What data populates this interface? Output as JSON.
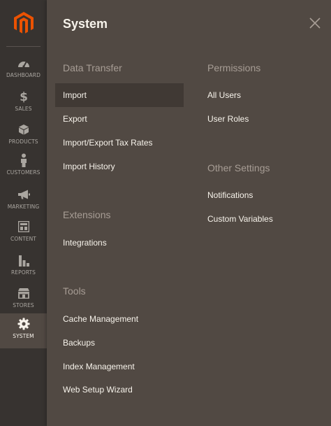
{
  "nav": {
    "items": [
      {
        "label": "DASHBOARD",
        "icon": "dashboard-icon"
      },
      {
        "label": "SALES",
        "icon": "dollar-icon"
      },
      {
        "label": "PRODUCTS",
        "icon": "box-icon"
      },
      {
        "label": "CUSTOMERS",
        "icon": "person-icon"
      },
      {
        "label": "MARKETING",
        "icon": "megaphone-icon"
      },
      {
        "label": "CONTENT",
        "icon": "layout-icon"
      },
      {
        "label": "REPORTS",
        "icon": "bar-chart-icon"
      },
      {
        "label": "STORES",
        "icon": "storefront-icon"
      },
      {
        "label": "SYSTEM",
        "icon": "gear-icon"
      }
    ],
    "active": "SYSTEM"
  },
  "panel": {
    "title": "System",
    "sections": {
      "data_transfer": {
        "title": "Data Transfer",
        "links": [
          "Import",
          "Export",
          "Import/Export Tax Rates",
          "Import History"
        ]
      },
      "extensions": {
        "title": "Extensions",
        "links": [
          "Integrations"
        ]
      },
      "tools": {
        "title": "Tools",
        "links": [
          "Cache Management",
          "Backups",
          "Index Management",
          "Web Setup Wizard"
        ]
      },
      "permissions": {
        "title": "Permissions",
        "links": [
          "All Users",
          "User Roles"
        ]
      },
      "other_settings": {
        "title": "Other Settings",
        "links": [
          "Notifications",
          "Custom Variables"
        ]
      }
    }
  },
  "colors": {
    "nav_bg": "#373330",
    "panel_bg": "#514943",
    "hover_bg": "#403934",
    "brand_orange": "#eb5202",
    "section_title": "#a79d95",
    "link_text": "#f7f3eb"
  }
}
